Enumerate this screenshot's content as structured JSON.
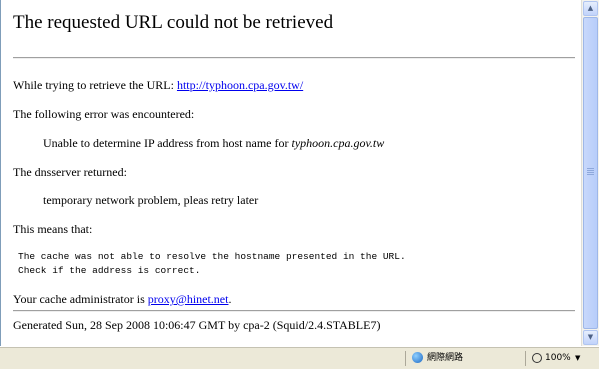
{
  "page": {
    "title": "The requested URL could not be retrieved",
    "retrieve_prefix": "While trying to retrieve the URL: ",
    "url": "http://typhoon.cpa.gov.tw/",
    "error_intro": "The following error was encountered:",
    "error_prefix": "Unable to determine IP address from host name for ",
    "error_host": "typhoon.cpa.gov.tw",
    "dns_intro": "The dnsserver returned:",
    "dns_message": "temporary network problem, pleas retry later",
    "means_intro": "This means that:",
    "explanation_line1": "The cache was not able to resolve the hostname presented in the URL.",
    "explanation_line2": "Check if the address is correct.",
    "admin_prefix": "Your cache administrator is ",
    "admin_email": "proxy@hinet.net",
    "admin_suffix": ".",
    "footer": "Generated Sun, 28 Sep 2008 10:06:47 GMT by cpa-2 (Squid/2.4.STABLE7)"
  },
  "statusbar": {
    "zone_label": "網際網路",
    "zone_icon": "globe-icon",
    "zoom_label": "100%",
    "zoom_icon": "magnifier-icon"
  }
}
